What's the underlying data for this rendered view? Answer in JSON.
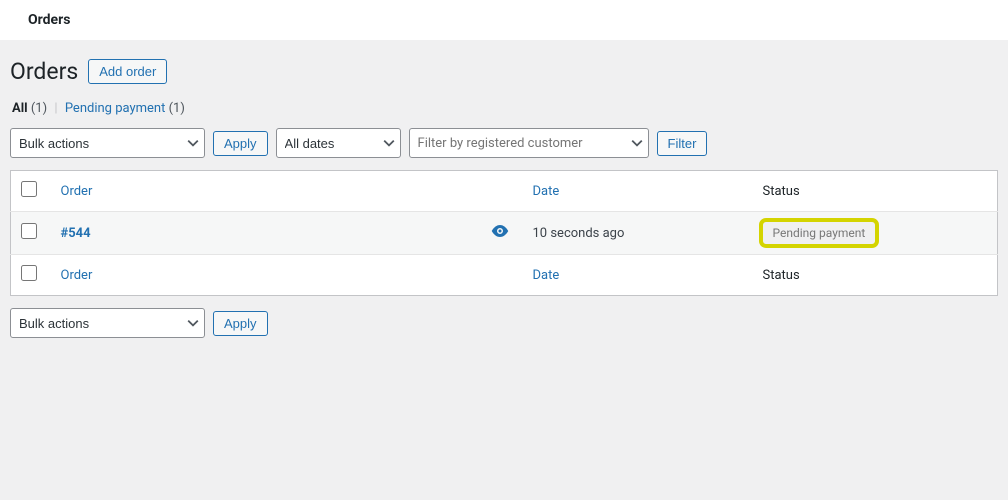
{
  "topbar": {
    "title": "Orders"
  },
  "page": {
    "title": "Orders",
    "add_button": "Add order"
  },
  "subsubsub": {
    "all_label": "All",
    "all_count": "(1)",
    "sep": "|",
    "pending_label": "Pending payment",
    "pending_count": "(1)"
  },
  "filters": {
    "bulk_actions": "Bulk actions",
    "apply": "Apply",
    "all_dates": "All dates",
    "customer_placeholder": "Filter by registered customer",
    "filter": "Filter"
  },
  "table": {
    "headers": {
      "order": "Order",
      "date": "Date",
      "status": "Status"
    },
    "row": {
      "order": "#544",
      "date": "10 seconds ago",
      "status": "Pending payment"
    }
  },
  "bottom": {
    "bulk_actions": "Bulk actions",
    "apply": "Apply"
  }
}
